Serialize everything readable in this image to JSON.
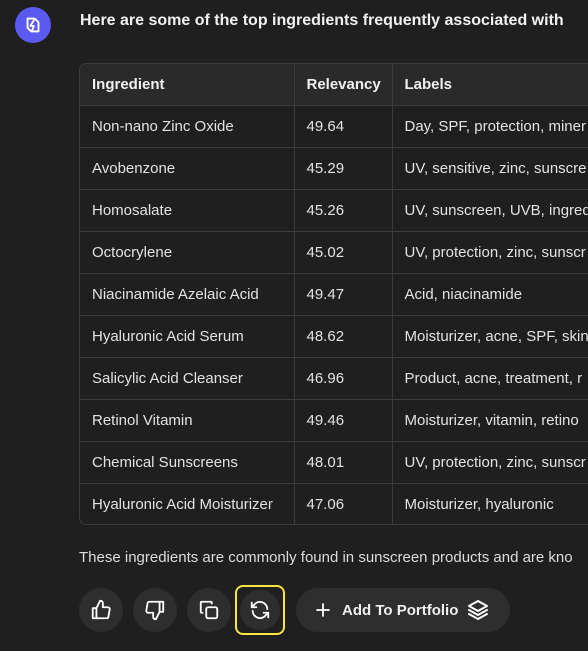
{
  "message": {
    "intro": "Here are some of the top ingredients frequently associated with",
    "summary": "These ingredients are commonly found in sunscreen products and are kno"
  },
  "table": {
    "headers": [
      "Ingredient",
      "Relevancy",
      "Labels"
    ],
    "rows": [
      [
        "Non-nano Zinc Oxide",
        "49.64",
        "Day, SPF, protection, miner"
      ],
      [
        "Avobenzone",
        "45.29",
        "UV, sensitive, zinc, sunscre"
      ],
      [
        "Homosalate",
        "45.26",
        "UV, sunscreen, UVB, ingred"
      ],
      [
        "Octocrylene",
        "45.02",
        "UV, protection, zinc, sunscr"
      ],
      [
        "Niacinamide Azelaic Acid",
        "49.47",
        "Acid, niacinamide"
      ],
      [
        "Hyaluronic Acid Serum",
        "48.62",
        "Moisturizer, acne, SPF, skin"
      ],
      [
        "Salicylic Acid Cleanser",
        "46.96",
        "Product, acne, treatment, r"
      ],
      [
        "Retinol Vitamin",
        "49.46",
        "Moisturizer, vitamin, retino"
      ],
      [
        "Chemical Sunscreens",
        "48.01",
        "UV, protection, zinc, sunscr"
      ],
      [
        "Hyaluronic Acid Moisturizer",
        "47.06",
        "Moisturizer, hyaluronic"
      ]
    ]
  },
  "actions": {
    "add_to_portfolio_label": "Add To Portfolio",
    "icons": [
      "thumbs-up-icon",
      "thumbs-down-icon",
      "copy-icon",
      "regenerate-icon",
      "plus-icon",
      "layers-icon"
    ]
  },
  "colors": {
    "avatar": "#5a5af0",
    "highlight": "#f5e642",
    "background": "#1f1f1f"
  }
}
